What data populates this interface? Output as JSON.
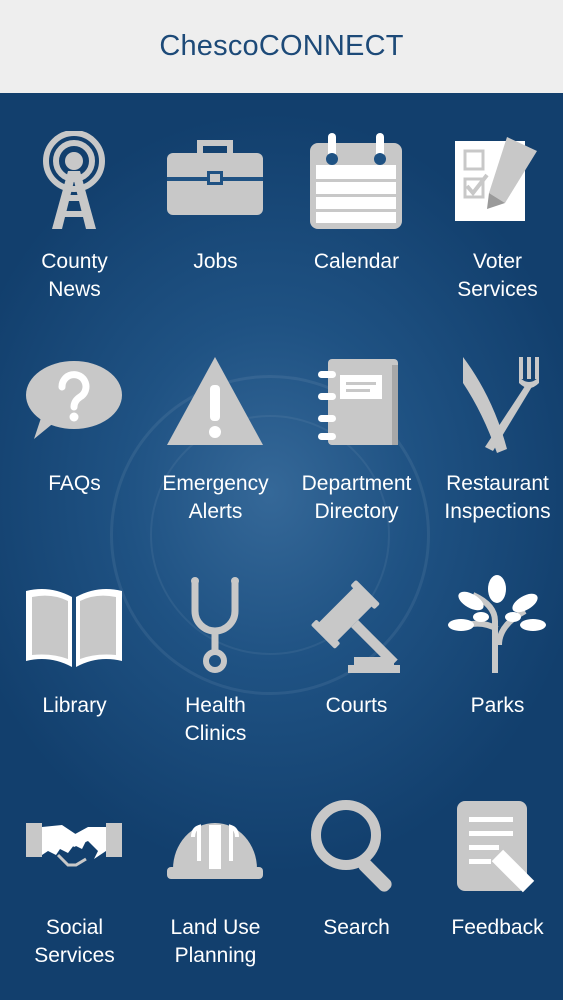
{
  "app": {
    "title": "ChescoCONNECT"
  },
  "colors": {
    "header_bg": "#eeeeee",
    "title_text": "#1d4a78",
    "background": "#1f5283",
    "icon": "#c8c8c8",
    "label": "#ffffff"
  },
  "tiles": [
    {
      "label": "County\nNews",
      "icon": "broadcast-tower-icon"
    },
    {
      "label": "Jobs",
      "icon": "briefcase-icon"
    },
    {
      "label": "Calendar",
      "icon": "calendar-icon"
    },
    {
      "label": "Voter\nServices",
      "icon": "ballot-checkbox-icon"
    },
    {
      "label": "FAQs",
      "icon": "question-bubble-icon"
    },
    {
      "label": "Emergency\nAlerts",
      "icon": "warning-triangle-icon"
    },
    {
      "label": "Department\nDirectory",
      "icon": "address-book-icon"
    },
    {
      "label": "Restaurant\nInspections",
      "icon": "knife-fork-icon"
    },
    {
      "label": "Library",
      "icon": "open-book-icon"
    },
    {
      "label": "Health\nClinics",
      "icon": "stethoscope-icon"
    },
    {
      "label": "Courts",
      "icon": "gavel-icon"
    },
    {
      "label": "Parks",
      "icon": "tree-icon"
    },
    {
      "label": "Social\nServices",
      "icon": "handshake-icon"
    },
    {
      "label": "Land Use\nPlanning",
      "icon": "hard-hat-icon"
    },
    {
      "label": "Search",
      "icon": "magnifier-icon"
    },
    {
      "label": "Feedback",
      "icon": "document-pen-icon"
    }
  ]
}
